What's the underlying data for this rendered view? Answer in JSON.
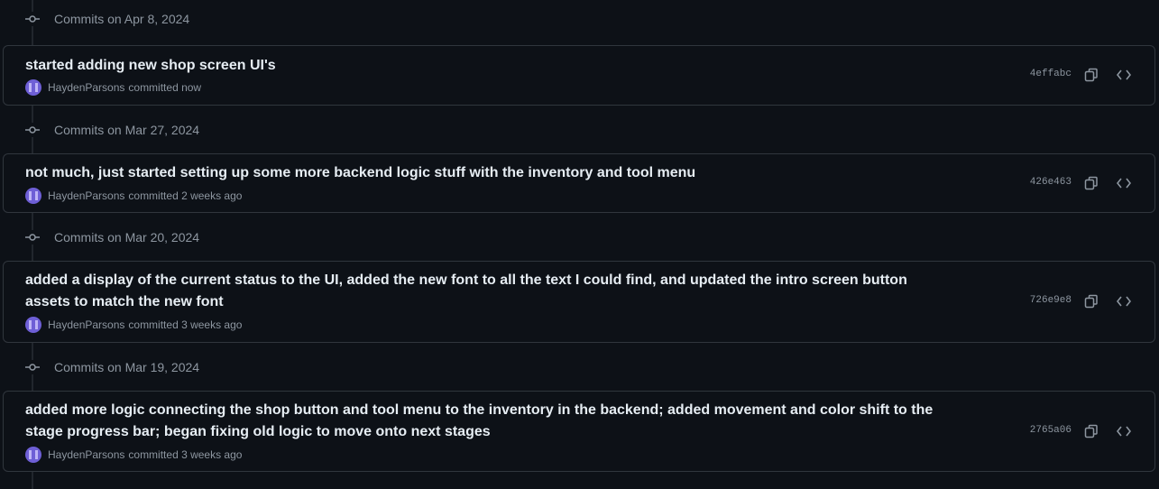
{
  "groups": [
    {
      "date_label": "Commits on Apr 8, 2024",
      "commit": {
        "title": "started adding new shop screen UI's",
        "author": "HaydenParsons",
        "time": "committed now",
        "sha": "4effabc"
      }
    },
    {
      "date_label": "Commits on Mar 27, 2024",
      "commit": {
        "title": "not much, just started setting up some more backend logic stuff with the inventory and tool menu",
        "author": "HaydenParsons",
        "time": "committed 2 weeks ago",
        "sha": "426e463"
      }
    },
    {
      "date_label": "Commits on Mar 20, 2024",
      "commit": {
        "title": "added a display of the current status to the UI, added the new font to all the text I could find, and updated the intro screen button assets to match the new font",
        "author": "HaydenParsons",
        "time": "committed 3 weeks ago",
        "sha": "726e9e8"
      }
    },
    {
      "date_label": "Commits on Mar 19, 2024",
      "commit": {
        "title": "added more logic connecting the shop button and tool menu to the inventory in the backend; added movement and color shift to the stage progress bar; began fixing old logic to move onto next stages",
        "author": "HaydenParsons",
        "time": "committed 3 weeks ago",
        "sha": "2765a06"
      }
    }
  ],
  "icons": {
    "commit": "git-commit-icon",
    "copy": "copy-icon",
    "browse": "code-icon"
  },
  "colors": {
    "background": "#0d1117",
    "border": "#30363d",
    "text": "#e6edf3",
    "muted": "#8d96a0"
  }
}
